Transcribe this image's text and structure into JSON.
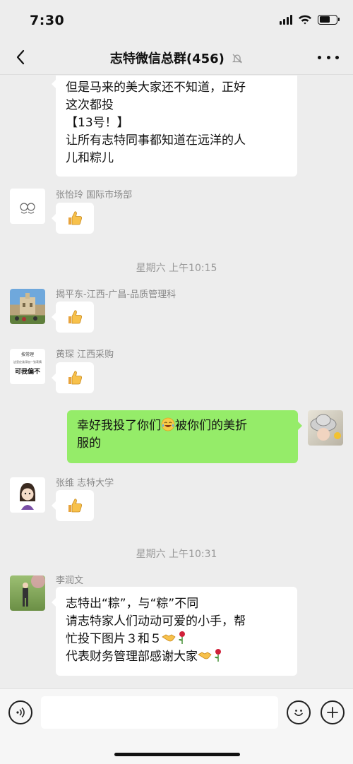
{
  "status": {
    "time": "7:30"
  },
  "header": {
    "title": "志特微信总群(456)"
  },
  "messages": {
    "m1": {
      "lines": [
        "但是马来的美大家还不知道，正好",
        "这次都投",
        "【13号！】",
        "让所有志特同事都知道在远洋的人",
        "儿和粽儿"
      ]
    },
    "m2": {
      "sender": "张怡玲  国际市场部"
    },
    "t1": "星期六 上午10:15",
    "m3": {
      "sender": "揭平东-江西-广昌-品质管理科"
    },
    "m4": {
      "sender": "黄琛  江西采购",
      "avatar_text_1": "按常理",
      "avatar_text_2": "这里应该添加一张表情",
      "avatar_text_3": "可我偏不"
    },
    "m5": {
      "line1_a": "幸好我投了你们",
      "line1_b": "被你们的美折",
      "line2": "服的"
    },
    "m6": {
      "sender": "张维  志特大学"
    },
    "t2": "星期六 上午10:31",
    "m7": {
      "sender": "李润文",
      "line1": "志特出“粽”，与“粽”不同",
      "line2": "请志特家人们动动可爱的小手，帮",
      "line3": "忙投下图片３和５",
      "line4": "代表财务管理部感谢大家"
    }
  },
  "icons": {
    "thumbs_up": "thumbs-up-emoji",
    "crying_laughing": "crying-laughing-emoji",
    "handshake": "handshake-emoji",
    "rose": "rose-emoji"
  },
  "colors": {
    "outgoing_bubble": "#95ec69",
    "incoming_bubble": "#ffffff",
    "background": "#ededed"
  }
}
